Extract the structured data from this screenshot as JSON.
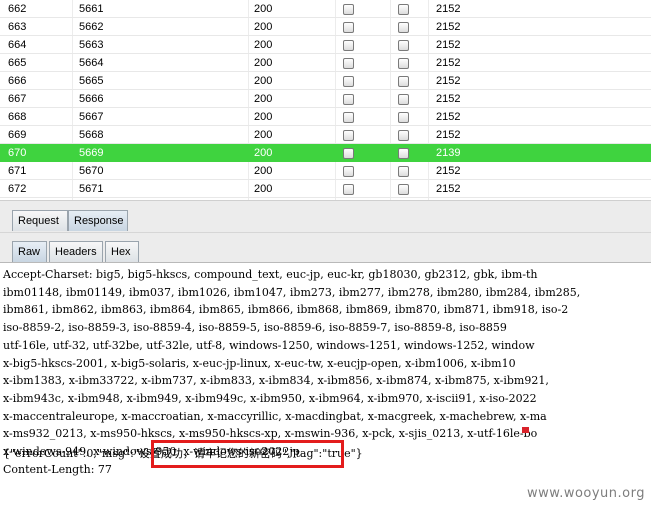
{
  "results": {
    "rows": [
      {
        "num": "662",
        "payload": "5661",
        "status": "200",
        "timeout": false,
        "error": false,
        "length": "2152"
      },
      {
        "num": "663",
        "payload": "5662",
        "status": "200",
        "timeout": false,
        "error": false,
        "length": "2152"
      },
      {
        "num": "664",
        "payload": "5663",
        "status": "200",
        "timeout": false,
        "error": false,
        "length": "2152"
      },
      {
        "num": "665",
        "payload": "5664",
        "status": "200",
        "timeout": false,
        "error": false,
        "length": "2152"
      },
      {
        "num": "666",
        "payload": "5665",
        "status": "200",
        "timeout": false,
        "error": false,
        "length": "2152"
      },
      {
        "num": "667",
        "payload": "5666",
        "status": "200",
        "timeout": false,
        "error": false,
        "length": "2152"
      },
      {
        "num": "668",
        "payload": "5667",
        "status": "200",
        "timeout": false,
        "error": false,
        "length": "2152"
      },
      {
        "num": "669",
        "payload": "5668",
        "status": "200",
        "timeout": false,
        "error": false,
        "length": "2152"
      },
      {
        "num": "670",
        "payload": "5669",
        "status": "200",
        "timeout": false,
        "error": false,
        "length": "2139",
        "selected": true
      },
      {
        "num": "671",
        "payload": "5670",
        "status": "200",
        "timeout": false,
        "error": false,
        "length": "2152"
      },
      {
        "num": "672",
        "payload": "5671",
        "status": "200",
        "timeout": false,
        "error": false,
        "length": "2152"
      }
    ]
  },
  "tabs": {
    "request": "Request",
    "response": "Response"
  },
  "view_tabs": {
    "raw": "Raw",
    "headers": "Headers",
    "hex": "Hex"
  },
  "response": {
    "lines": [
      "Accept-Charset: big5, big5-hkscs, compound_text, euc-jp, euc-kr, gb18030, gb2312, gbk, ibm-th",
      "ibm01148, ibm01149, ibm037, ibm1026, ibm1047, ibm273, ibm277, ibm278, ibm280, ibm284, ibm285,",
      "ibm861, ibm862, ibm863, ibm864, ibm865, ibm866, ibm868, ibm869, ibm870, ibm871, ibm918, iso-2",
      "iso-8859-2, iso-8859-3, iso-8859-4, iso-8859-5, iso-8859-6, iso-8859-7, iso-8859-8, iso-8859",
      "utf-16le, utf-32, utf-32be, utf-32le, utf-8, windows-1250, windows-1251, windows-1252, window",
      "x-big5-hkscs-2001, x-big5-solaris, x-euc-jp-linux, x-euc-tw, x-eucjp-open, x-ibm1006, x-ibm10",
      "x-ibm1383, x-ibm33722, x-ibm737, x-ibm833, x-ibm834, x-ibm856, x-ibm874, x-ibm875, x-ibm921,",
      "x-ibm943c, x-ibm948, x-ibm949, x-ibm949c, x-ibm950, x-ibm964, x-ibm970, x-iscii91, x-iso-2022",
      "x-maccentraleurope, x-maccroatian, x-maccyrillic, x-macdingbat, x-macgreek, x-machebrew, x-ma",
      "x-ms932_0213, x-ms950-hkscs, x-ms950-hkscs-xp, x-mswin-936, x-pck, x-sjis_0213, x-utf-16le-bo",
      "x-windows-949, x-windows-950, x-windows-iso2022jp",
      "Content-Length: 77"
    ],
    "json_body": "{\"errorCount\":0,\"msg\":\"设置成功，请牢记您的新密码\",\"tag\":\"true\"}"
  },
  "watermark": "www.wooyun.org",
  "colors": {
    "selected_row": "#3fd33f",
    "highlight_box": "#e31c1c"
  }
}
